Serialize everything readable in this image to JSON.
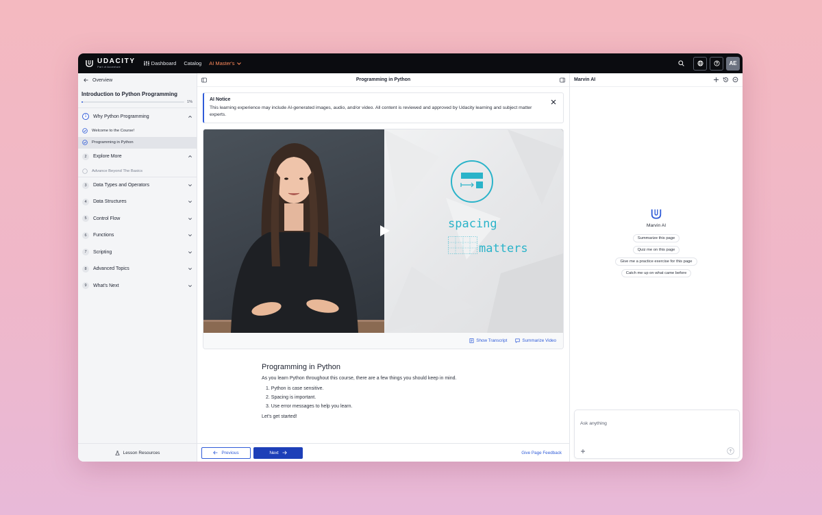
{
  "topnav": {
    "brand": "UDACITY",
    "brand_sub": "Part of Accenture",
    "links": [
      {
        "label": "Dashboard"
      },
      {
        "label": "Catalog"
      },
      {
        "label": "AI Master's"
      }
    ],
    "avatar_initials": "AE",
    "icons": [
      "search-icon",
      "globe-icon",
      "help-icon"
    ]
  },
  "sidebar": {
    "back_label": "Overview",
    "course_title": "Introduction to Python Programming",
    "progress": 1,
    "progress_label": "1%",
    "sections": [
      {
        "num": "1",
        "label": "Why Python Programming",
        "expanded": true,
        "items": [
          {
            "label": "Welcome to the Course!",
            "done": true
          },
          {
            "label": "Programming in Python",
            "done": true,
            "selected": true
          }
        ]
      },
      {
        "num": "2",
        "label": "Explore More",
        "expanded": true,
        "items": [
          {
            "label": "Advance Beyond The Basics",
            "done": false
          }
        ]
      },
      {
        "num": "3",
        "label": "Data Types and Operators"
      },
      {
        "num": "4",
        "label": "Data Structures"
      },
      {
        "num": "5",
        "label": "Control Flow"
      },
      {
        "num": "6",
        "label": "Functions"
      },
      {
        "num": "7",
        "label": "Scripting"
      },
      {
        "num": "8",
        "label": "Advanced Topics"
      },
      {
        "num": "9",
        "label": "What's Next"
      }
    ],
    "footer_label": "Lesson Resources"
  },
  "center": {
    "title": "Programming in Python",
    "notice": {
      "title": "AI Notice",
      "text": "This learning experience may include AI-generated images, audio, and/or video. All content is reviewed and approved by Udacity learning and subject matter experts."
    },
    "video": {
      "slide_word1": "spacing",
      "slide_word2": "matters",
      "show_transcript": "Show Transcript",
      "summarize_video": "Summarize Video"
    },
    "article": {
      "title": "Programming in Python",
      "intro": "As you learn Python throughout this course, there are a few things you should keep in mind.",
      "list": [
        "1. Python is case sensitive.",
        "2. Spacing is important.",
        "3. Use error messages to help you learn."
      ],
      "outro": "Let's get started!"
    },
    "footer": {
      "previous": "Previous",
      "next": "Next",
      "feedback": "Give Page Feedback"
    }
  },
  "assistant": {
    "title": "Marvin AI",
    "name": "Marvin AI",
    "suggestions": [
      "Summarize this page",
      "Quiz me on this page",
      "Give me a practice exercise for this page",
      "Catch me up on what came before"
    ],
    "input_placeholder": "Ask anything"
  },
  "colors": {
    "accent": "#2f5bd8",
    "nav_bg": "#0b0c10",
    "nav_accent": "#ff8a5c",
    "slide_text": "#2ab3c9"
  }
}
